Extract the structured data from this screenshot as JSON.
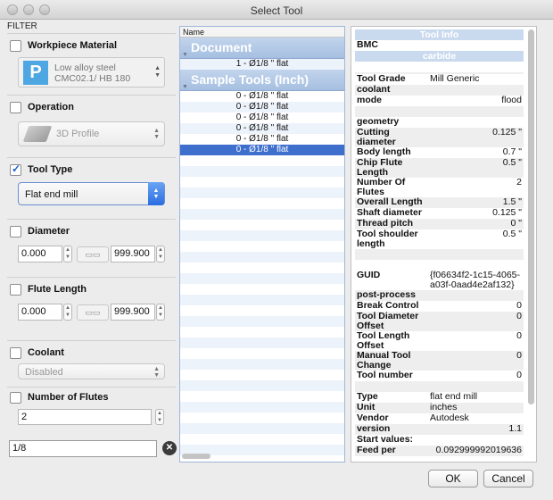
{
  "window": {
    "title": "Select Tool"
  },
  "filter": {
    "header": "FILTER",
    "workpiece": {
      "label": "Workpiece Material",
      "checked": false,
      "tile": "P",
      "line1": "Low alloy steel",
      "line2": "CMC02.1/ HB 180"
    },
    "operation": {
      "label": "Operation",
      "checked": false,
      "value": "3D Profile"
    },
    "tool_type": {
      "label": "Tool Type",
      "checked": true,
      "value": "Flat end mill"
    },
    "diameter": {
      "label": "Diameter",
      "checked": false,
      "min": "0.000",
      "max": "999.900"
    },
    "flute_length": {
      "label": "Flute Length",
      "checked": false,
      "min": "0.000",
      "max": "999.900"
    },
    "coolant": {
      "label": "Coolant",
      "checked": false,
      "value": "Disabled"
    },
    "flutes": {
      "label": "Number of Flutes",
      "checked": false,
      "value": "2"
    },
    "search": {
      "value": "1/8"
    }
  },
  "list": {
    "header": "Name",
    "groups": [
      {
        "name": "Document",
        "items": [
          "1 - Ø1/8 \" flat"
        ]
      },
      {
        "name": "Sample Tools (Inch)",
        "items": [
          "0 - Ø1/8 \" flat",
          "0 - Ø1/8 \" flat",
          "0 - Ø1/8 \" flat",
          "0 - Ø1/8 \" flat",
          "0 - Ø1/8 \" flat",
          "0 - Ø1/8 \" flat"
        ]
      }
    ]
  },
  "info": {
    "title": "Tool Info",
    "material_label": "BMC",
    "material_bar": "carbide",
    "tool_grade_k": "Tool Grade",
    "tool_grade_v": "Mill Generic",
    "coolant_k": "coolant",
    "mode_k": "mode",
    "mode_v": "flood",
    "geometry_k": "geometry",
    "cutting_diameter_k": "Cutting diameter",
    "cutting_diameter_v": "0.125 \"",
    "body_length_k": "Body length",
    "body_length_v": "0.7 \"",
    "chip_flute_k": "Chip Flute Length",
    "chip_flute_v": "0.5 \"",
    "num_flutes_k": "Number Of Flutes",
    "num_flutes_v": "2",
    "overall_length_k": "Overall Length",
    "overall_length_v": "1.5 \"",
    "shaft_diameter_k": "Shaft diameter",
    "shaft_diameter_v": "0.125 \"",
    "thread_pitch_k": "Thread pitch",
    "thread_pitch_v": "0 \"",
    "shoulder_length_k": "Tool shoulder length",
    "shoulder_length_v": "0.5 \"",
    "guid_k": "GUID",
    "guid_v": "{f06634f2-1c15-4065-a03f-0aad4e2af132}",
    "post_process_k": "post-process",
    "break_control_k": "Break Control",
    "break_control_v": "0",
    "diameter_offset_k": "Tool Diameter Offset",
    "diameter_offset_v": "0",
    "length_offset_k": "Tool Length Offset",
    "length_offset_v": "0",
    "manual_tool_change_k": "Manual Tool Change",
    "manual_tool_change_v": "0",
    "tool_number_k": "Tool number",
    "tool_number_v": "0",
    "type_k": "Type",
    "type_v": "flat end mill",
    "unit_k": "Unit",
    "unit_v": "inches",
    "vendor_k": "Vendor",
    "vendor_v": "Autodesk",
    "version_k": "version",
    "version_v": "1.1",
    "start_values_k": "Start values:",
    "feed_per_k": "Feed per",
    "feed_per_v": "0.092999992019636"
  },
  "buttons": {
    "ok": "OK",
    "cancel": "Cancel"
  }
}
